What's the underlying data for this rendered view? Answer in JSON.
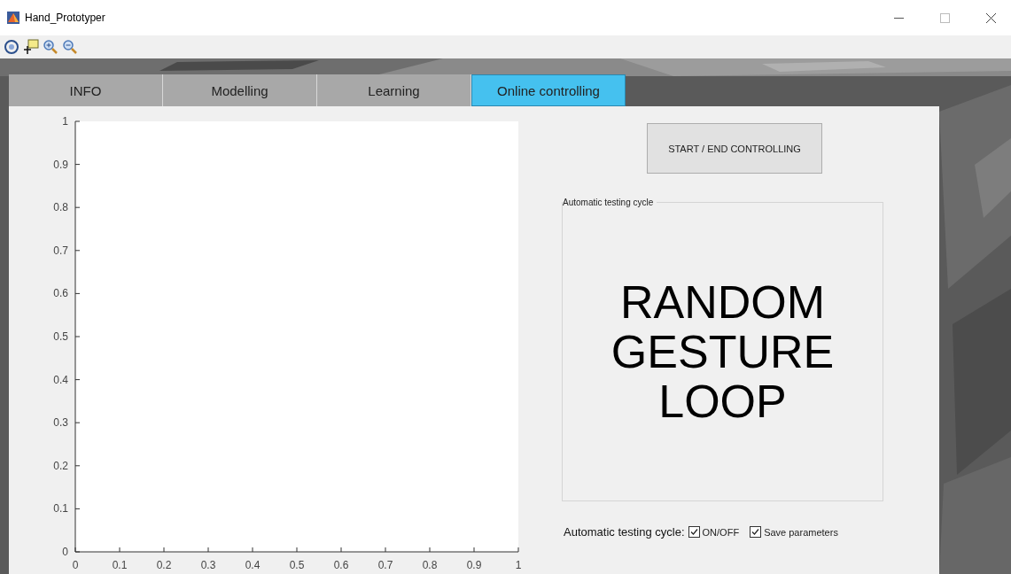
{
  "window": {
    "title": "Hand_Prototyper"
  },
  "tabs": [
    {
      "label": "INFO",
      "selected": false
    },
    {
      "label": "Modelling",
      "selected": false
    },
    {
      "label": "Learning",
      "selected": false
    },
    {
      "label": "Online controlling",
      "selected": true
    }
  ],
  "plot": {
    "chart_data": {
      "type": "line",
      "xlim": [
        0,
        1
      ],
      "ylim": [
        0,
        1
      ],
      "xticks": [
        0,
        0.1,
        0.2,
        0.3,
        0.4,
        0.5,
        0.6,
        0.7,
        0.8,
        0.9,
        1
      ],
      "yticks": [
        0,
        0.1,
        0.2,
        0.3,
        0.4,
        0.5,
        0.6,
        0.7,
        0.8,
        0.9,
        1
      ]
    }
  },
  "start_button": "START / END CONTROLLING",
  "group": {
    "title": "Automatic testing cycle",
    "display": "RANDOM GESTURE LOOP"
  },
  "options": {
    "label": "Automatic testing cycle:",
    "checkboxes": [
      {
        "label": "ON/OFF",
        "checked": true
      },
      {
        "label": "Save parameters",
        "checked": true
      }
    ]
  }
}
